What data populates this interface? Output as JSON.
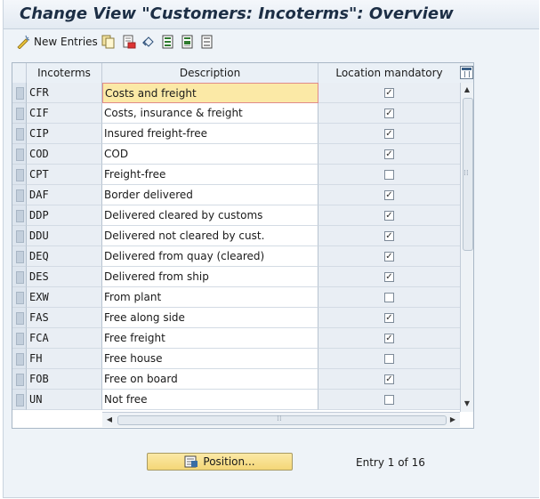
{
  "window": {
    "title": "Change View \"Customers: Incoterms\": Overview"
  },
  "toolbar": {
    "new_entries_label": "New Entries",
    "icons": [
      "new-entries-icon",
      "copy-icon",
      "delete-icon",
      "undo-icon",
      "select-all-icon",
      "select-block-icon",
      "deselect-all-icon"
    ]
  },
  "table": {
    "columns": [
      "Incoterms",
      "Description",
      "Location mandatory"
    ],
    "rows": [
      {
        "code": "CFR",
        "description": "Costs and freight",
        "location_mandatory": true
      },
      {
        "code": "CIF",
        "description": "Costs, insurance & freight",
        "location_mandatory": true
      },
      {
        "code": "CIP",
        "description": "Insured freight-free",
        "location_mandatory": true
      },
      {
        "code": "COD",
        "description": "COD",
        "location_mandatory": true
      },
      {
        "code": "CPT",
        "description": "Freight-free",
        "location_mandatory": false
      },
      {
        "code": "DAF",
        "description": "Border delivered",
        "location_mandatory": true
      },
      {
        "code": "DDP",
        "description": "Delivered cleared by customs",
        "location_mandatory": true
      },
      {
        "code": "DDU",
        "description": "Delivered not cleared by cust.",
        "location_mandatory": true
      },
      {
        "code": "DEQ",
        "description": "Delivered from quay (cleared)",
        "location_mandatory": true
      },
      {
        "code": "DES",
        "description": "Delivered from ship",
        "location_mandatory": true
      },
      {
        "code": "EXW",
        "description": "From plant",
        "location_mandatory": false
      },
      {
        "code": "FAS",
        "description": "Free along side",
        "location_mandatory": true
      },
      {
        "code": "FCA",
        "description": "Free freight",
        "location_mandatory": true
      },
      {
        "code": "FH",
        "description": "Free house",
        "location_mandatory": false
      },
      {
        "code": "FOB",
        "description": "Free on board",
        "location_mandatory": true
      },
      {
        "code": "UN",
        "description": "Not free",
        "location_mandatory": false
      }
    ]
  },
  "footer": {
    "position_button_label": "Position...",
    "entry_info": "Entry 1 of 16"
  },
  "colors": {
    "accent_button": "#f4d777",
    "header_bg": "#eaf0f6",
    "title_text": "#1c2e45"
  }
}
